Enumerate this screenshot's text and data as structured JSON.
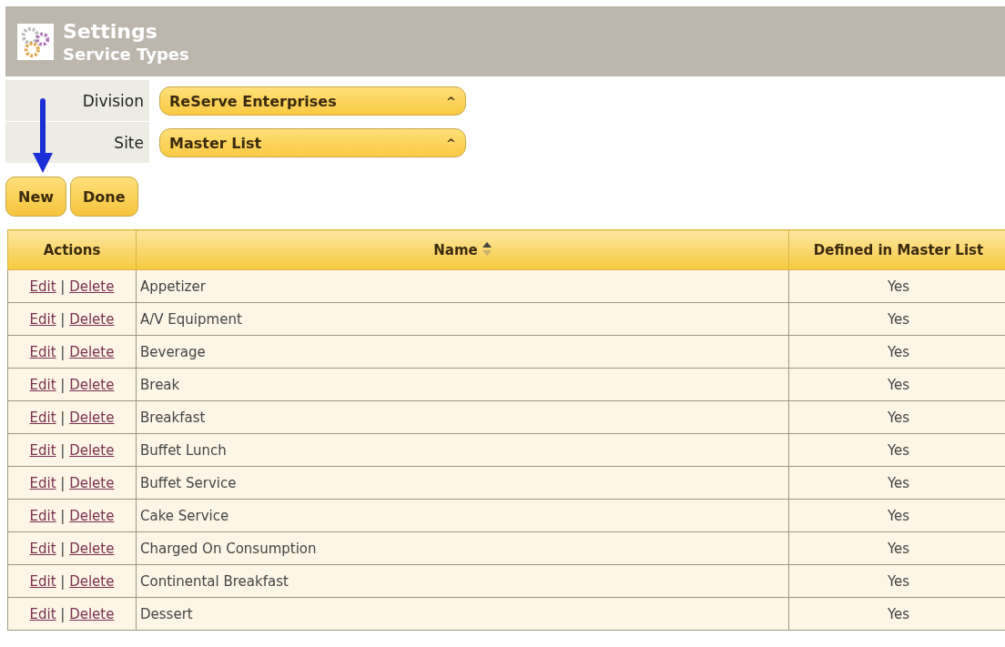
{
  "header": {
    "title": "Settings",
    "subtitle": "Service Types"
  },
  "filters": [
    {
      "label": "Division",
      "value": "ReServe Enterprises",
      "caret": "^"
    },
    {
      "label": "Site",
      "value": "Master List",
      "caret": "^"
    }
  ],
  "buttons": [
    "New",
    "Done"
  ],
  "table": {
    "columns": [
      "Actions",
      "Name",
      "Defined in Master List"
    ],
    "rows": [
      {
        "edit": "Edit",
        "separator": "|",
        "delete": "Delete",
        "name": "Appetizer",
        "defined": "Yes"
      },
      {
        "edit": "Edit",
        "separator": "|",
        "delete": "Delete",
        "name": "A/V Equipment",
        "defined": "Yes"
      },
      {
        "edit": "Edit",
        "separator": "|",
        "delete": "Delete",
        "name": "Beverage",
        "defined": "Yes"
      },
      {
        "edit": "Edit",
        "separator": "|",
        "delete": "Delete",
        "name": "Break",
        "defined": "Yes"
      },
      {
        "edit": "Edit",
        "separator": "|",
        "delete": "Delete",
        "name": "Breakfast",
        "defined": "Yes"
      },
      {
        "edit": "Edit",
        "separator": "|",
        "delete": "Delete",
        "name": "Buffet Lunch",
        "defined": "Yes"
      },
      {
        "edit": "Edit",
        "separator": "|",
        "delete": "Delete",
        "name": "Buffet Service",
        "defined": "Yes"
      },
      {
        "edit": "Edit",
        "separator": "|",
        "delete": "Delete",
        "name": "Cake Service",
        "defined": "Yes"
      },
      {
        "edit": "Edit",
        "separator": "|",
        "delete": "Delete",
        "name": "Charged On Consumption",
        "defined": "Yes"
      },
      {
        "edit": "Edit",
        "separator": "|",
        "delete": "Delete",
        "name": "Continental Breakfast",
        "defined": "Yes"
      },
      {
        "edit": "Edit",
        "separator": "|",
        "delete": "Delete",
        "name": "Dessert",
        "defined": "Yes"
      }
    ]
  }
}
